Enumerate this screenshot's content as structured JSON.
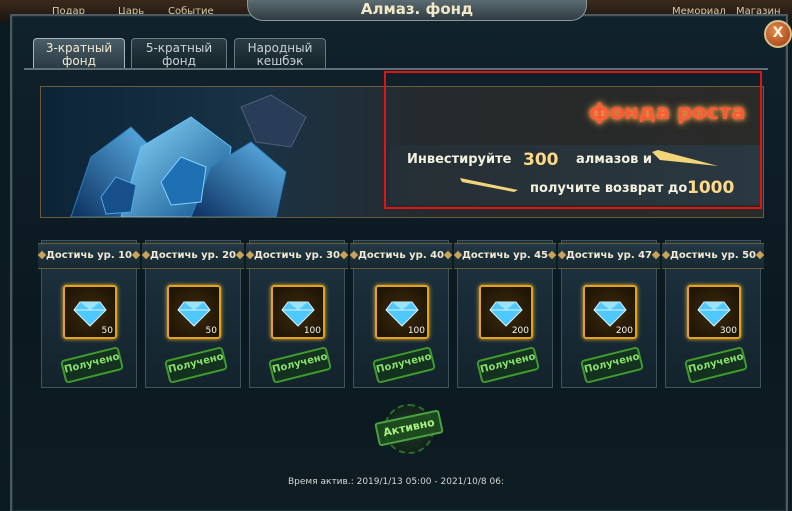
{
  "window": {
    "title": "Алмаз. фонд",
    "close_label": "X"
  },
  "top_strip": {
    "labels": [
      "Подар",
      "Царь",
      "Событие",
      "Мемориал",
      "Магазин"
    ]
  },
  "tabs": [
    {
      "label": "3-кратный фонд",
      "active": true
    },
    {
      "label": "5-кратный фонд",
      "active": false
    },
    {
      "label": "Народный кешбэк",
      "active": false
    }
  ],
  "banner": {
    "title": "фонда роста",
    "invest_prefix": "Инвестируйте",
    "invest_amount": "300",
    "invest_suffix": "алмазов и",
    "return_prefix": "получите возврат до",
    "return_amount": "1000"
  },
  "rewards": [
    {
      "requirement": "Достичь ур. 10",
      "quantity": "50",
      "status": "Получено"
    },
    {
      "requirement": "Достичь ур. 20",
      "quantity": "50",
      "status": "Получено"
    },
    {
      "requirement": "Достичь ур. 30",
      "quantity": "100",
      "status": "Получено"
    },
    {
      "requirement": "Достичь ур. 40",
      "quantity": "100",
      "status": "Получено"
    },
    {
      "requirement": "Достичь ур. 45",
      "quantity": "200",
      "status": "Получено"
    },
    {
      "requirement": "Достичь ур. 47",
      "quantity": "200",
      "status": "Получено"
    },
    {
      "requirement": "Достичь ур. 50",
      "quantity": "300",
      "status": "Получено"
    }
  ],
  "status_stamp": "Активно",
  "footer": {
    "time": "Время актив.: 2019/1/13 05:00 - 2021/10/8 06:"
  },
  "colors": {
    "highlight_border": "#e11414",
    "stamp_green": "#4aa040",
    "diamond": "#4fc8ff",
    "banner_title": "#ff5a3a"
  }
}
